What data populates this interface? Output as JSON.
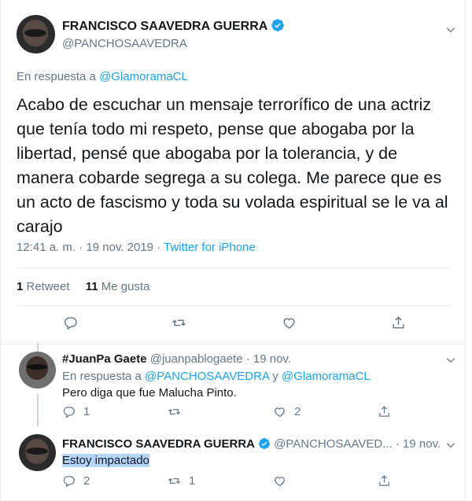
{
  "main_tweet": {
    "author_name": "FRANCISCO SAAVEDRA GUERRA",
    "handle": "@PANCHOSAAVEDRA",
    "reply_prefix": "En respuesta a ",
    "reply_to": "@GlamoramaCL",
    "text": "Acabo de escuchar un mensaje terrorífico de una actriz que tenía todo mi respeto, pense que abogaba por la libertad, pensé que abogaba por la tolerancia, y de manera cobarde segrega a su colega. Me parece que es un acto de fascismo y toda su volada espiritual se le va al carajo",
    "time": "12:41 a. m. · 19 nov. 2019 · ",
    "source": "Twitter for iPhone",
    "retweet_count": "1",
    "retweet_label": " Retweet",
    "like_count": "11",
    "like_label": " Me gusta"
  },
  "replies": [
    {
      "author_name": "#JuanPa Gaete",
      "handle_date": " @juanpablogaete · 19 nov.",
      "reply_prefix": "En respuesta a ",
      "reply_to_1": "@PANCHOSAAVEDRA",
      "reply_joiner": " y ",
      "reply_to_2": "@GlamoramaCL",
      "text": "Pero diga que fue Malucha Pinto.",
      "reply_count": "1",
      "retweet_count": "",
      "like_count": "2"
    },
    {
      "author_name": "FRANCISCO SAAVEDRA GUERRA",
      "handle_date": " @PANCHOSAAVED... · 19 nov.",
      "text": "Estoy impactado",
      "reply_count": "2",
      "retweet_count": "1",
      "like_count": ""
    }
  ],
  "colors": {
    "link": "#1da1f2",
    "secondary_text": "#657786",
    "primary_text": "#14171a",
    "selection": "#b4d5fe",
    "verified": "#1da1f2"
  },
  "icons": [
    "chevron-down-icon",
    "verified-badge-icon",
    "reply-icon",
    "retweet-icon",
    "like-icon",
    "share-icon"
  ]
}
